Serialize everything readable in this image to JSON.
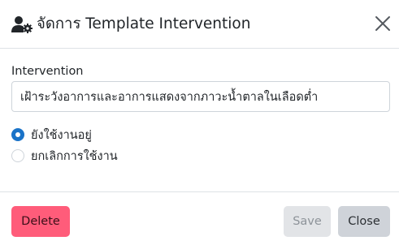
{
  "header": {
    "title": "จัดการ Template Intervention",
    "close_icon": "close-icon",
    "header_icon": "user-gear-icon"
  },
  "form": {
    "intervention_label": "Intervention",
    "intervention_value": "เฝ้าระวังอาการและอาการแสดงจากภาวะน้ำตาลในเลือดต่ำ",
    "status_options": [
      {
        "label": "ยังใช้งานอยู่",
        "checked": true
      },
      {
        "label": "ยกเลิกการใช้งาน",
        "checked": false
      }
    ]
  },
  "footer": {
    "delete_label": "Delete",
    "save_label": "Save",
    "close_label": "Close"
  },
  "colors": {
    "delete": "#ff5c7a",
    "save_disabled": "#e2e4e7",
    "close": "#cfd3d9",
    "radio_checked": "#1a73c8"
  }
}
